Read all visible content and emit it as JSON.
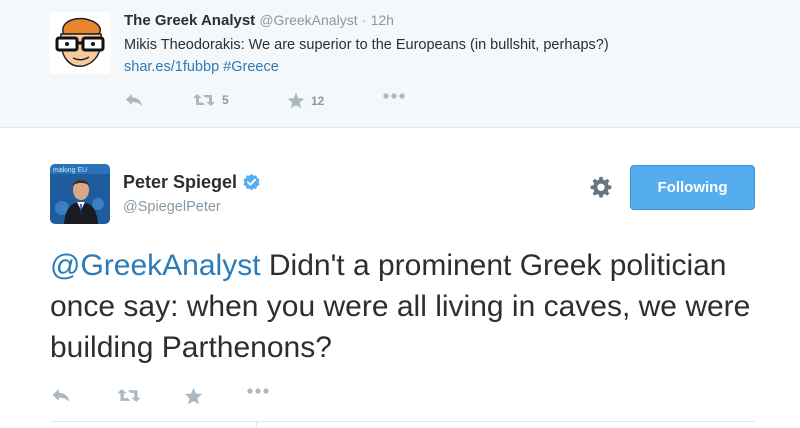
{
  "parent_tweet": {
    "author_name": "The Greek Analyst",
    "author_handle": "@GreekAnalyst",
    "separator": "·",
    "time": "12h",
    "text": "Mikis Theodorakis: We are superior to the Europeans (in bullshit, perhaps?)",
    "link": "shar.es/1fubbp",
    "hashtag": "#Greece",
    "retweet_count": "5",
    "favorite_count": "12",
    "avatar_icon": "cartoon-glasses-face-icon"
  },
  "main_tweet": {
    "author_name": "Peter Spiegel",
    "author_handle": "@SpiegelPeter",
    "verified": true,
    "follow_button_label": "Following",
    "mention": "@GreekAnalyst",
    "text": " Didn't a prominent Greek politician once say: when you were all living in caves, we were building Parthenons?",
    "avatar_text": "making EU"
  },
  "colors": {
    "link": "#2b7bb9",
    "follow_button": "#55acee",
    "icon_gray": "#aab8c2",
    "parent_background": "#f5f8fa"
  }
}
